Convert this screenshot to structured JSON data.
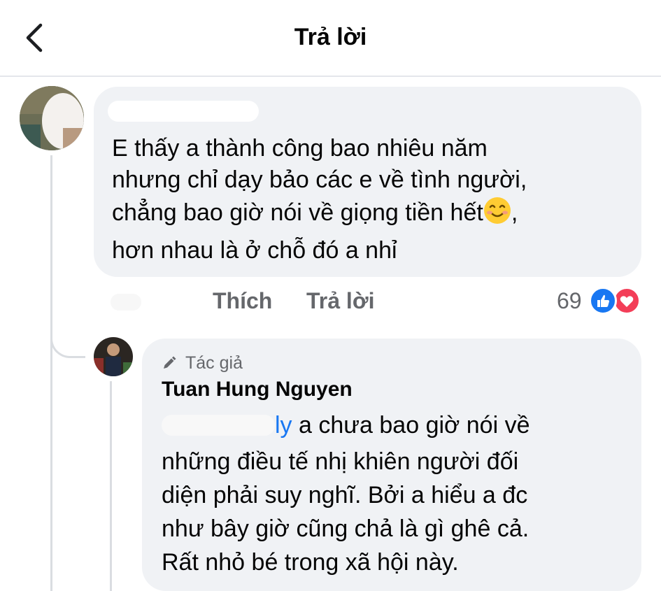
{
  "header": {
    "title": "Trả lời"
  },
  "comment": {
    "lines": [
      "E thấy a thành công bao nhiêu năm",
      "nhưng chỉ dạy bảo các e về tình người,",
      "chẳng bao giờ nói về giọng tiền hết",
      "hơn nhau là ở chỗ đó a nhỉ"
    ],
    "line3_suffix": ",",
    "actions": {
      "like": "Thích",
      "reply": "Trả lời"
    },
    "reaction_count": "69",
    "reaction_icons": [
      "like-icon",
      "love-icon"
    ],
    "colors": {
      "like": "#1877f2",
      "love": "#f33e58"
    }
  },
  "reply": {
    "author_badge": "Tác giả",
    "author_name": "Tuan Hung Nguyen",
    "mention_tail": "ly",
    "lines": [
      " a chưa bao giờ nói về",
      "những điều tế nhị khiên người đối",
      "diện phải suy nghĩ. Bởi a hiểu a đc",
      "như bây giờ cũng chả là gì ghê cả.",
      "Rất nhỏ bé trong xã hội này."
    ]
  }
}
